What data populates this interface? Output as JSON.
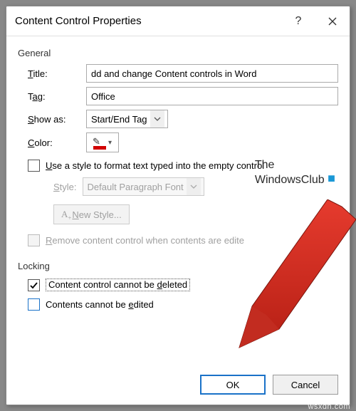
{
  "dialog": {
    "title": "Content Control Properties"
  },
  "general": {
    "label": "General",
    "title_label": "Title:",
    "title_value": "dd and change Content controls in Word",
    "tag_label": "Tag:",
    "tag_value": "Office",
    "showas_label": "Show as:",
    "showas_value": "Start/End Tag",
    "color_label": "Color:",
    "use_style_label": "Use a style to format text typed into the empty control",
    "style_label": "Style:",
    "style_value": "Default Paragraph Font",
    "newstyle_label": "New Style...",
    "remove_label": "Remove content control when contents are edite"
  },
  "locking": {
    "label": "Locking",
    "cannot_delete": "Content control cannot be deleted",
    "cannot_edit": "Contents cannot be edited"
  },
  "buttons": {
    "ok": "OK",
    "cancel": "Cancel"
  },
  "watermark": {
    "line1": "The",
    "line2": "WindowsClub"
  },
  "footer": "wsxdn.com"
}
